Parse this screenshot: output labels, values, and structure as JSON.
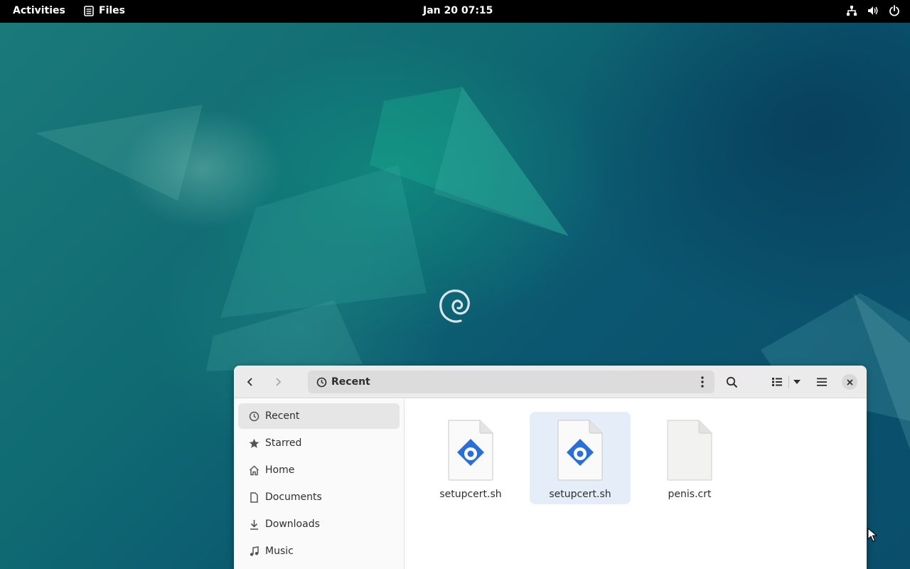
{
  "topbar": {
    "activities": "Activities",
    "app_name": "Files",
    "clock": "Jan 20  07:15",
    "tray_icons": [
      "network-icon",
      "volume-icon",
      "power-icon"
    ]
  },
  "window": {
    "location": "Recent",
    "sidebar": {
      "items": [
        {
          "label": "Recent",
          "icon": "clock-icon",
          "active": true
        },
        {
          "label": "Starred",
          "icon": "star-icon"
        },
        {
          "label": "Home",
          "icon": "home-icon"
        },
        {
          "label": "Documents",
          "icon": "document-icon"
        },
        {
          "label": "Downloads",
          "icon": "download-icon"
        },
        {
          "label": "Music",
          "icon": "music-icon"
        }
      ]
    },
    "files": [
      {
        "name": "setupcert.sh",
        "type": "script",
        "selected": false
      },
      {
        "name": "setupcert.sh",
        "type": "script",
        "selected": true
      },
      {
        "name": "penis.crt",
        "type": "generic",
        "selected": false
      }
    ]
  },
  "colors": {
    "topbar_bg": "#000000",
    "selection": "#e4edf8",
    "script_icon_blue": "#2a6fd6"
  }
}
